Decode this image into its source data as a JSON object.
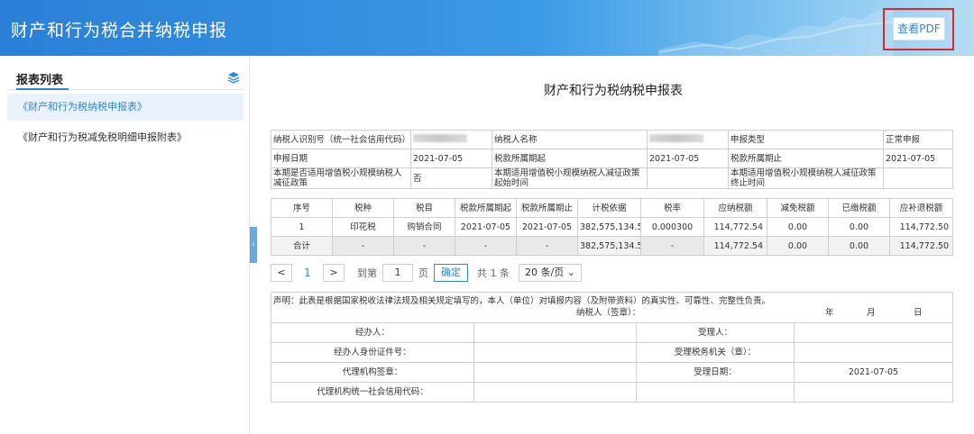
{
  "header": {
    "title": "财产和行为税合并纳税申报",
    "pdf_button": "查看PDF"
  },
  "sidebar": {
    "title": "报表列表",
    "items": [
      {
        "label": "《财产和行为税纳税申报表》"
      },
      {
        "label": "《财产和行为税减免税明细申报附表》"
      }
    ]
  },
  "report": {
    "title": "财产和行为税纳税申报表",
    "info": {
      "taxpayer_id_label": "纳税人识别号（统一社会信用代码）",
      "taxpayer_name_label": "纳税人名称",
      "declaration_type_label": "申报类型",
      "declaration_type_value": "正常申报",
      "declaration_date_label": "申报日期",
      "declaration_date_value": "2021-07-05",
      "period_start_label": "税款所属期起",
      "period_start_value": "2021-07-05",
      "period_end_label": "税款所属期止",
      "period_end_value": "2021-07-05",
      "small_scale_label": "本期是否适用增值税小规模纳税人减征政策",
      "small_scale_value": "否",
      "policy_start_label": "本期适用增值税小规模纳税人减征政策起始时间",
      "policy_end_label": "本期适用增值税小规模纳税人减征政策终止时间"
    },
    "tax_table": {
      "headers": [
        "序号",
        "税种",
        "税目",
        "税款所属期起",
        "税款所属期止",
        "计税依据",
        "税率",
        "应纳税额",
        "减免税额",
        "已缴税额",
        "应补退税额"
      ],
      "rows": [
        [
          "1",
          "印花税",
          "购销合同",
          "2021-07-05",
          "2021-07-05",
          "382,575,134.53",
          "0.000300",
          "114,772.54",
          "0.00",
          "0.00",
          "114,772.50"
        ]
      ],
      "total": [
        "合计",
        "-",
        "-",
        "-",
        "-",
        "382,575,134.53",
        "-",
        "114,772.54",
        "0.00",
        "0.00",
        "114,772.50"
      ]
    },
    "pager": {
      "prev": "<",
      "current": "1",
      "next": ">",
      "goto_label": "到第",
      "goto_value": "1",
      "page_unit": "页",
      "confirm": "确定",
      "total": "共 1 条",
      "page_size": "20 条/页"
    },
    "declaration": {
      "statement": "声明：此表是根据国家税收法律法规及相关规定填写的，本人（单位）对填报内容（及附带资料）的真实性、可靠性、完整性负责。",
      "taxpayer_sign": "纳税人（签章）：",
      "year": "年",
      "month": "月",
      "day": "日",
      "agent_label": "经办人：",
      "agent_id_label": "经办人身份证件号：",
      "agency_seal_label": "代理机构签章：",
      "agency_credit_label": "代理机构统一社会信用代码：",
      "receiver_label": "受理人：",
      "tax_office_label": "受理税务机关（章）：",
      "receive_date_label": "受理日期：",
      "receive_date_value": "2021-07-05"
    }
  },
  "colors": {
    "primary": "#2f86dd",
    "highlight_border": "#e02525"
  }
}
